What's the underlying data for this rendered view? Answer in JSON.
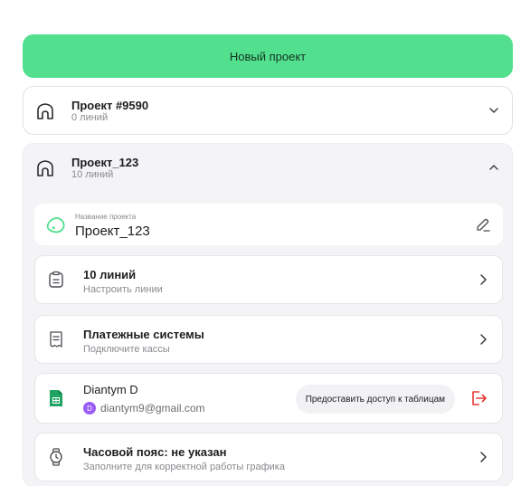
{
  "new_project_label": "Новый проект",
  "projects": [
    {
      "title": "Проект #9590",
      "subtitle": "0 линий"
    },
    {
      "title": "Проект_123",
      "subtitle": "10 линий"
    }
  ],
  "details": {
    "name_field": {
      "label": "Название проекта",
      "value": "Проект_123"
    },
    "lines": {
      "title": "10 линий",
      "subtitle": "Настроить линии"
    },
    "payments": {
      "title": "Платежные системы",
      "subtitle": "Подключите кассы"
    },
    "sheets": {
      "user_name": "Diantym D",
      "avatar_letter": "D",
      "email": "diantym9@gmail.com",
      "share_label": "Предоставить доступ к таблицам"
    },
    "timezone": {
      "title": "Часовой пояс: не указан",
      "subtitle": "Заполните для корректной работы графика"
    }
  },
  "colors": {
    "accent": "#52e08f",
    "logout": "#e53935",
    "sheets": "#1fa463",
    "avatar": "#9b5cf6"
  }
}
